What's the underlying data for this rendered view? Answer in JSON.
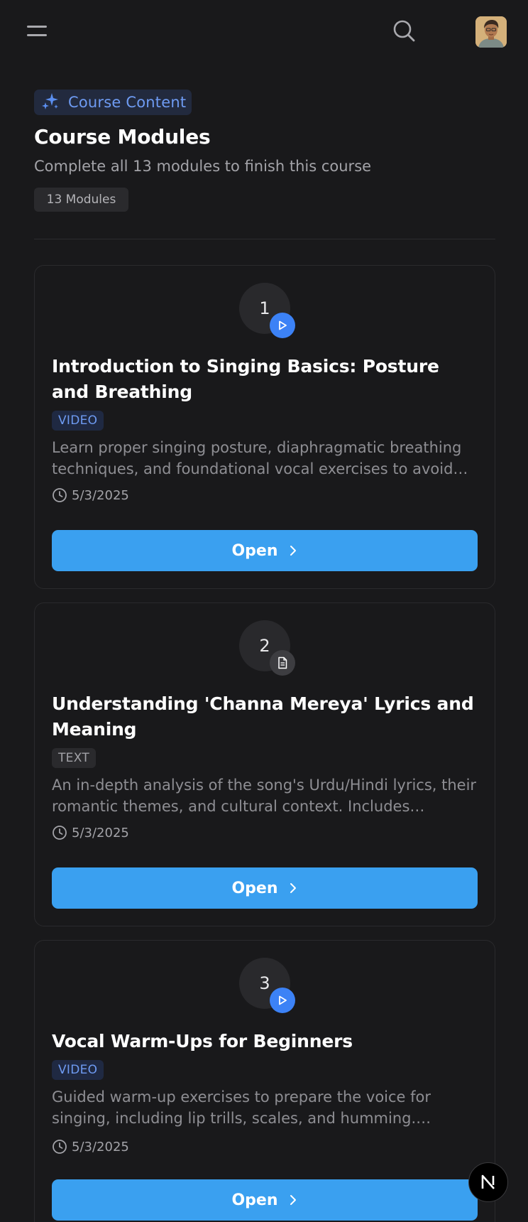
{
  "header": {
    "menu_icon": "menu-icon",
    "search_icon": "search-icon",
    "avatar_icon": "user-avatar"
  },
  "course": {
    "badge_label": "Course Content",
    "badge_icon": "sparkles-icon",
    "title": "Course Modules",
    "subtitle": "Complete all 13 modules to finish this course",
    "count_label": "13 Modules"
  },
  "modules": [
    {
      "number": "1",
      "type": "video",
      "type_label": "VIDEO",
      "title": "Introduction to Singing Basics: Posture and Breathing",
      "description": "Learn proper singing posture, diaphragmatic breathing techniques, and foundational vocal exercises to avoid…",
      "date": "5/3/2025",
      "button_label": "Open"
    },
    {
      "number": "2",
      "type": "text",
      "type_label": "TEXT",
      "title": "Understanding 'Channa Mereya' Lyrics and Meaning",
      "description": "An in-depth analysis of the song's Urdu/Hindi lyrics, their romantic themes, and cultural context. Includes…",
      "date": "5/3/2025",
      "button_label": "Open"
    },
    {
      "number": "3",
      "type": "video",
      "type_label": "VIDEO",
      "title": "Vocal Warm-Ups for Beginners",
      "description": "Guided warm-up exercises to prepare the voice for singing, including lip trills, scales, and humming. Focuse…",
      "date": "5/3/2025",
      "button_label": "Open"
    }
  ],
  "fab": {
    "label": "N"
  },
  "colors": {
    "background": "#19191b",
    "accent_blue": "#3aa0f0",
    "video_blue": "#3c82f6",
    "badge_text": "#6e9bf2"
  }
}
